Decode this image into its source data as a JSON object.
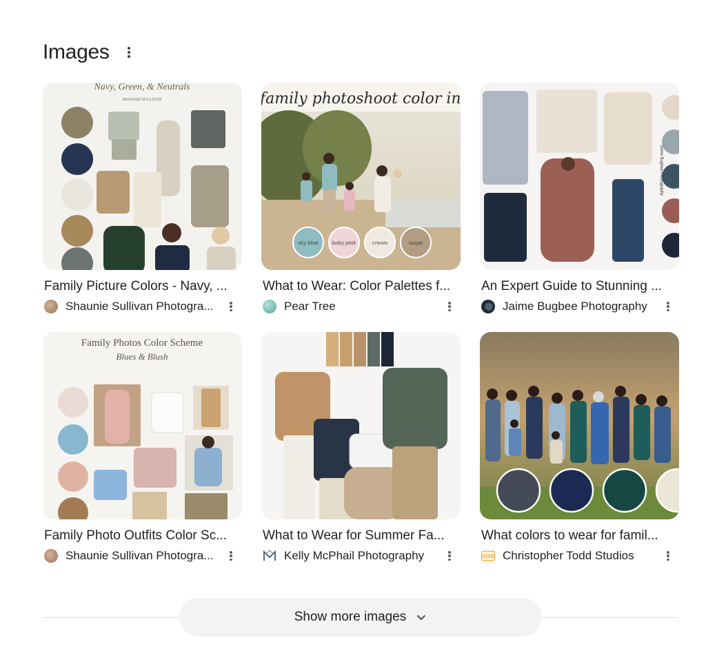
{
  "section": {
    "title": "Images",
    "menu_icon": "more-vert-icon"
  },
  "cards": [
    {
      "title": "Family Picture Colors - Navy, ...",
      "source": "Shaunie Sullivan Photogra...",
      "favicon_color": "#b08a6e",
      "thumb_text": "Navy, Green, & Neutrals",
      "thumb_sub": "SHAUNIE SULLIVAN"
    },
    {
      "title": "What to Wear: Color Palettes f...",
      "source": "Pear Tree",
      "favicon_color": "#6fb7ad",
      "thumb_text": "family photoshoot color inspo",
      "swatch_labels": [
        "sky blue",
        "baby pink",
        "cream",
        "taupe"
      ]
    },
    {
      "title": "An Expert Guide to Stunning ...",
      "source": "Jaime Bugbee Photography",
      "favicon_color": "#1f2a33",
      "thumb_text": "Jaime Bugbee Photography"
    },
    {
      "title": "Family Photo Outfits Color Sc...",
      "source": "Shaunie Sullivan Photogra...",
      "favicon_color": "#b08a6e",
      "thumb_text": "Family Photos Color Scheme",
      "thumb_sub": "Blues & Blush"
    },
    {
      "title": "What to Wear for Summer Fa...",
      "source": "Kelly McPhail Photography",
      "favicon_color": "#4a6a80"
    },
    {
      "title": "What colors to wear for famil...",
      "source": "Christopher Todd Studios",
      "favicon_color": "#f0a640"
    }
  ],
  "show_more": {
    "label": "Show more images",
    "icon": "chevron-down-icon"
  }
}
